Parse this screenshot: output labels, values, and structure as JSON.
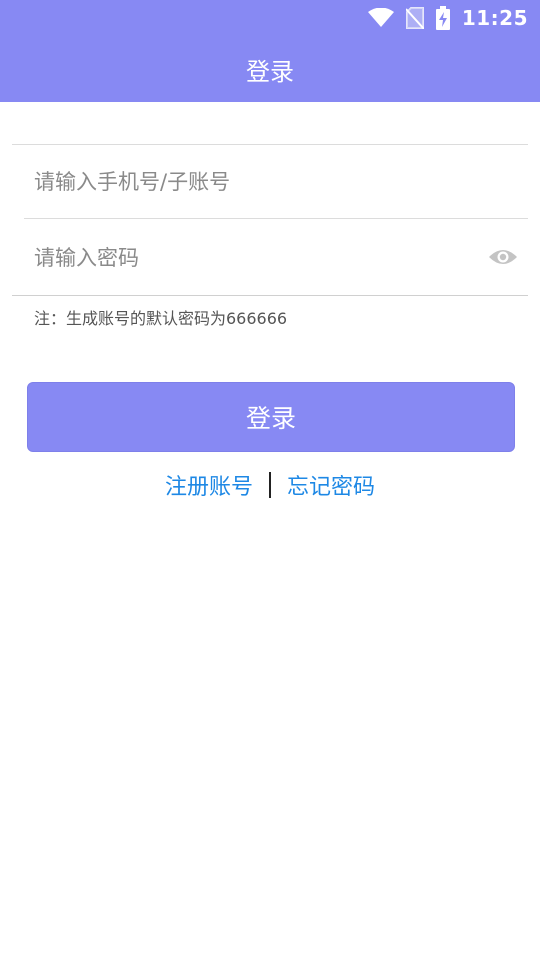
{
  "status_bar": {
    "time": "11:25",
    "icons": [
      "wifi-icon",
      "no-sim-icon",
      "battery-charging-icon"
    ]
  },
  "header": {
    "title": "登录",
    "background": "#8789f3"
  },
  "form": {
    "phone_placeholder": "请输入手机号/子账号",
    "password_placeholder": "请输入密码",
    "password_toggle_icon": "eye-icon"
  },
  "note": "注：生成账号的默认密码为666666",
  "login_button": {
    "label": "登录",
    "color": "#8789f3"
  },
  "links": {
    "register": "注册账号",
    "forgot": "忘记密码",
    "color": "#1e88e5"
  }
}
